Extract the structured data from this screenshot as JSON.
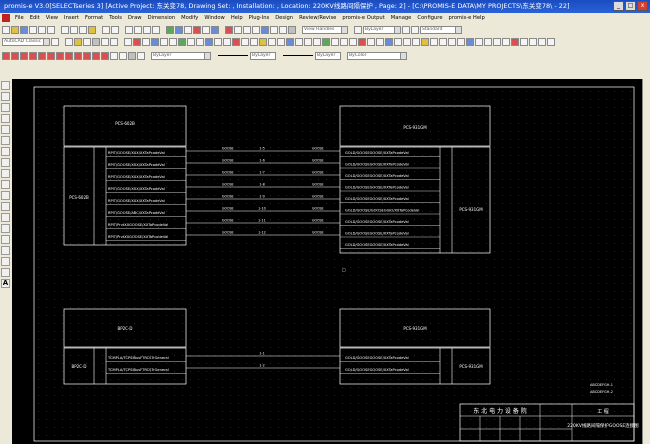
{
  "window": {
    "title": "promis-e V3.0[SELECTseries 3] [Active Project: 东关变78, Drawing Set: , Installation: , Location: 220KV线路间隔保护 , Page: 2] - [C:\\PROMIS-E DATA\\MY PROJECTS\\东关变78\\ - 22]",
    "minimize": "_",
    "maximize": "□",
    "close": "x"
  },
  "menu": {
    "items": [
      "File",
      "Edit",
      "View",
      "Insert",
      "Format",
      "Tools",
      "Draw",
      "Dimension",
      "Modify",
      "Window",
      "Help",
      "Plug-Ins",
      "Design",
      "Review/Revise",
      "promis-e Output",
      "Manage",
      "Configure",
      "promis-e Help"
    ]
  },
  "toolbar": {
    "layer_combo": "AutoCAD Classic",
    "view_combo": "View Handles",
    "color_combo": "ByLayer",
    "layer2_combo": "Standard",
    "linetype_combo": "ByLayer",
    "lineweight_combo": "ByLayer",
    "plotstyle_combo": "ByColor"
  },
  "drawing": {
    "top_left_box": {
      "title": "PCS-602B"
    },
    "top_left_sub": {
      "title": "PCS-602B"
    },
    "top_right_box": {
      "title": "PCS-931GM"
    },
    "top_right_sub": {
      "title": "PCS-931GM"
    },
    "left_ports": [
      "RPIT/GOOSE/XXX/XXTaPcodeVal",
      "RPIT/GOOSE/XXX/XXTaPcodeVal",
      "RPIT/GOOSE/XXX/XXTaPcodeVal",
      "RPIT/GOOSE/XXX/XXTaPcodeVal",
      "RPIT/GOOSE/XXX/XXTaPcodeVal",
      "RPIT/GOOSE/ABC/XXTaPcodeVal",
      "RPIT/PrvtXXGOOSE/XXTaPcodeVal",
      "RPIT/PrvtXXGOOSE/XXTaPcodeVal"
    ],
    "right_ports": [
      "GOLD/GOOSEGOOSE/XXTaPcodeVal",
      "GOLD/GOOSEGOOSE/XXTaPcodeVal",
      "GOLD/GOOSEGOOSE/XXTaPcodeVal",
      "GOLD/GOOSEGOOSE/XXTaPcodeVal",
      "GOLD/GOOSEGOOSE/XXTaPcodeVal",
      "GOLD/GOOSE/GOOSEGGIO/XXTaPcodeVal",
      "GOLD/GOOSEGOOSE/XXTaPcodeVal",
      "GOLD/GOOSEGOOSE/XXTaPcodeVal",
      "GOLD/GOOSEGOOSE/XXTaPcodeVal"
    ],
    "wire_labels": [
      "1-5",
      "1-6",
      "1-7",
      "1-8",
      "1-9",
      "1-10",
      "1-11",
      "1-12"
    ],
    "wire_left_tags": [
      "GOOSE",
      "GOOSE",
      "GOOSE",
      "GOOSE",
      "GOOSE",
      "GOOSE",
      "GOOSE",
      "GOOSE"
    ],
    "wire_right_tags": [
      "GOOSE",
      "GOOSE",
      "GOOSE",
      "GOOSE",
      "GOOSE",
      "GOOSE",
      "GOOSE",
      "GOOSE"
    ],
    "bottom_left_box": {
      "title": "BP2C-D"
    },
    "bottom_left_sub": {
      "title": "BP2C-D"
    },
    "bottom_right_box": {
      "title": "PCS-931GM"
    },
    "bottom_right_sub": {
      "title": "PCS-931GM"
    },
    "bottom_left_ports": [
      "TCMPLA/TCPSIBusFTRCSTrGeneral",
      "TCMPLA/TCPSIBusFTRCSTrGeneral"
    ],
    "bottom_right_ports": [
      "GOLD/GOOSEGOOSE/XXTaPcodeVal",
      "GOLD/GOOSEGOOSE/XXTaPcodeVal"
    ],
    "bottom_wire_labels": [
      "1-1",
      "1-2"
    ],
    "titleblock": {
      "company": "东 北 电 力 设 备 院",
      "number": "工 程",
      "drawing_title": "220KV线路间隔保护GOOSE连接图",
      "note_lines": [
        "ABCDEFGH-1",
        "ABCDEFGH-2"
      ]
    }
  }
}
